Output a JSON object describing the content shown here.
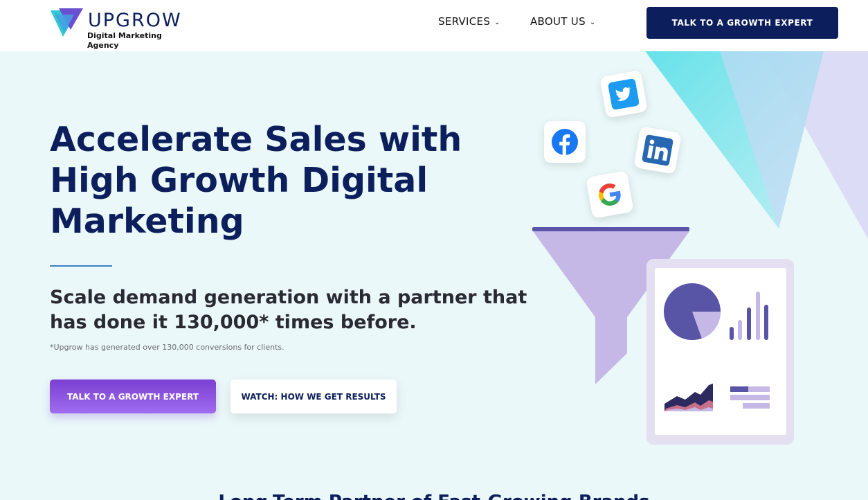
{
  "header": {
    "brand_name": "UPGROW",
    "brand_tagline": "Digital Marketing Agency",
    "nav": [
      {
        "label": "SERVICES"
      },
      {
        "label": "ABOUT US"
      }
    ],
    "cta_label": "TALK TO A GROWTH EXPERT"
  },
  "hero": {
    "title": "Accelerate Sales with High Growth Digital Marketing",
    "subtitle": "Scale demand generation with a partner that has done it 130,000* times before.",
    "footnote": "*Upgrow has generated over 130,000 conversions for clients.",
    "primary_button": "TALK TO A GROWTH EXPERT",
    "secondary_button": "WATCH: HOW WE GET RESULTS"
  },
  "illustration": {
    "social_icons": [
      "twitter-icon",
      "facebook-icon",
      "linkedin-icon",
      "google-icon"
    ]
  },
  "next_section_peek": "Long-Term Partner of Fast-Growing Brands",
  "colors": {
    "navy": "#0c1f5c",
    "purple_gradient_start": "#7a3fd1",
    "purple_gradient_end": "#9f6df0",
    "hero_bg": "#eaf8f9",
    "funnel_purple": "#c5b8e6",
    "twitter_blue": "#1d9bf0",
    "facebook_blue": "#1877f2",
    "linkedin_blue": "#2867b2"
  }
}
